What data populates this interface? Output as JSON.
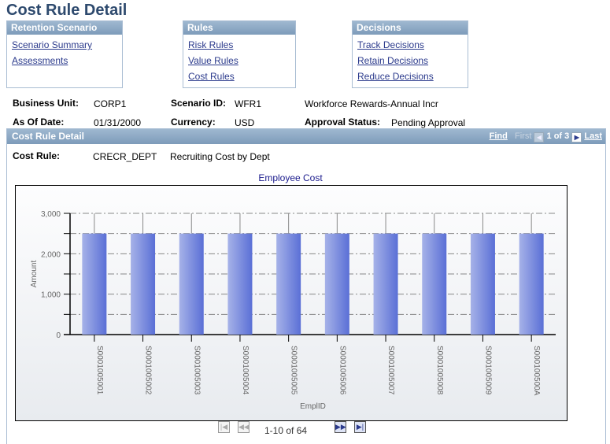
{
  "page_title": "Cost Rule Detail",
  "boxes": [
    {
      "title": "Retention Scenario",
      "links": [
        "Scenario Summary",
        "Assessments"
      ]
    },
    {
      "title": "Rules",
      "links": [
        "Risk Rules",
        "Value Rules",
        "Cost Rules"
      ]
    },
    {
      "title": "Decisions",
      "links": [
        "Track Decisions",
        "Retain Decisions",
        "Reduce Decisions"
      ]
    }
  ],
  "info": {
    "business_unit_label": "Business Unit:",
    "business_unit": "CORP1",
    "scenario_id_label": "Scenario ID:",
    "scenario_id": "WFR1",
    "scenario_desc": "Workforce Rewards-Annual Incr",
    "as_of_date_label": "As Of Date:",
    "as_of_date": "01/31/2000",
    "currency_label": "Currency:",
    "currency": "USD",
    "approval_status_label": "Approval Status:",
    "approval_status": "Pending Approval"
  },
  "detail": {
    "title": "Cost Rule Detail",
    "find": "Find",
    "first": "First",
    "count": "1 of 3",
    "last": "Last",
    "cost_rule_label": "Cost Rule:",
    "cost_rule": "CRECR_DEPT",
    "cost_rule_desc": "Recruiting Cost by Dept"
  },
  "chart_data": {
    "type": "bar",
    "title": "Employee Cost",
    "xlabel": "EmplID",
    "ylabel": "Amount",
    "ylim": [
      0,
      3000
    ],
    "yticks": [
      "0",
      "1,000",
      "2,000",
      "3,000"
    ],
    "grid": true,
    "bar_color": "#5a6fd6",
    "categories": [
      "S0001005001",
      "S0001005002",
      "S0001005003",
      "S0001005004",
      "S0001005005",
      "S0001005006",
      "S0001005007",
      "S0001005008",
      "S0001005009",
      "S000100500A"
    ],
    "values": [
      2500,
      2500,
      2500,
      2500,
      2500,
      2500,
      2500,
      2500,
      2500,
      2500
    ]
  },
  "pager": {
    "range": "1-10 of 64"
  }
}
